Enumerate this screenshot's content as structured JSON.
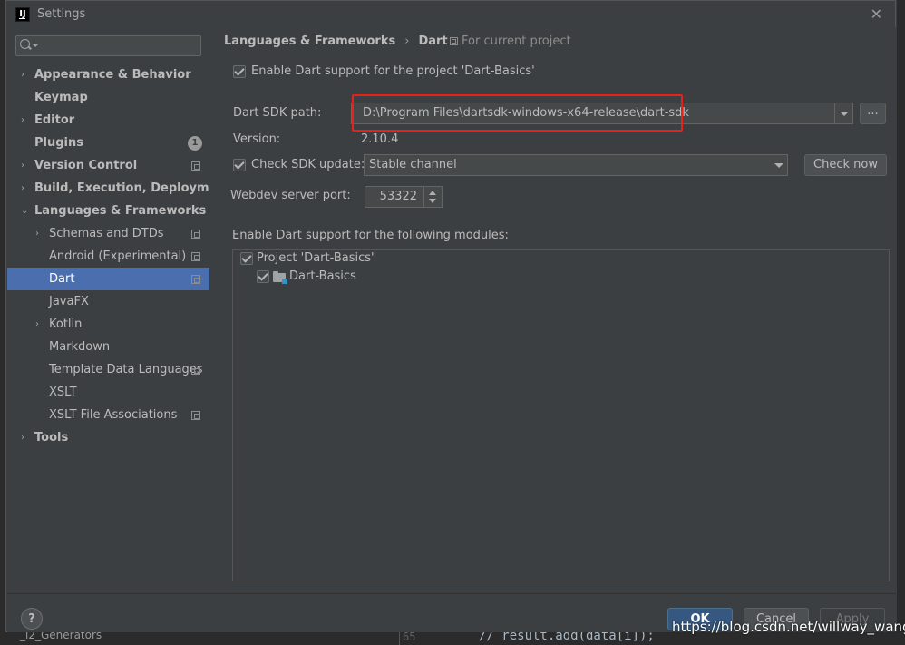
{
  "window": {
    "title": "Settings",
    "logo_text": "IJ"
  },
  "sidebar": {
    "search_placeholder": "",
    "items": [
      {
        "label": "Appearance & Behavior"
      },
      {
        "label": "Keymap"
      },
      {
        "label": "Editor"
      },
      {
        "label": "Plugins",
        "badge": "1"
      },
      {
        "label": "Version Control"
      },
      {
        "label": "Build, Execution, Deployment"
      },
      {
        "label": "Languages & Frameworks"
      },
      {
        "label": "Schemas and DTDs"
      },
      {
        "label": "Android (Experimental)"
      },
      {
        "label": "Dart"
      },
      {
        "label": "JavaFX"
      },
      {
        "label": "Kotlin"
      },
      {
        "label": "Markdown"
      },
      {
        "label": "Template Data Languages"
      },
      {
        "label": "XSLT"
      },
      {
        "label": "XSLT File Associations"
      },
      {
        "label": "Tools"
      }
    ]
  },
  "main": {
    "breadcrumb": [
      "Languages & Frameworks",
      "Dart"
    ],
    "breadcrumb_sep": "›",
    "for_project": "For current project",
    "enable_label": "Enable Dart support for the project 'Dart-Basics'",
    "sdk_path_label": "Dart SDK path:",
    "sdk_path_value": "D:\\Program Files\\dartsdk-windows-x64-release\\dart-sdk",
    "browse_label": "...",
    "version_label": "Version:",
    "version_value": "2.10.4",
    "check_update_label": "Check SDK update:",
    "channel_value": "Stable channel",
    "check_now_label": "Check now",
    "webdev_port_label": "Webdev server port:",
    "webdev_port_value": "53322",
    "modules_label": "Enable Dart support for the following modules:",
    "modules": [
      {
        "label": "Project 'Dart-Basics'"
      },
      {
        "label": "Dart-Basics"
      }
    ]
  },
  "footer": {
    "help": "?",
    "ok": "OK",
    "cancel": "Cancel",
    "apply": "Apply"
  },
  "behind": {
    "line_number": "65",
    "code": "//      result.add(data[i]);",
    "project_item": "_i2_Generators"
  },
  "watermark": "https://blog.csdn.net/willway_wang",
  "colors": {
    "selection": "#4b6eaf",
    "highlight_box": "#e8211a",
    "ok_button": "#365880",
    "background": "#3c3f41"
  }
}
